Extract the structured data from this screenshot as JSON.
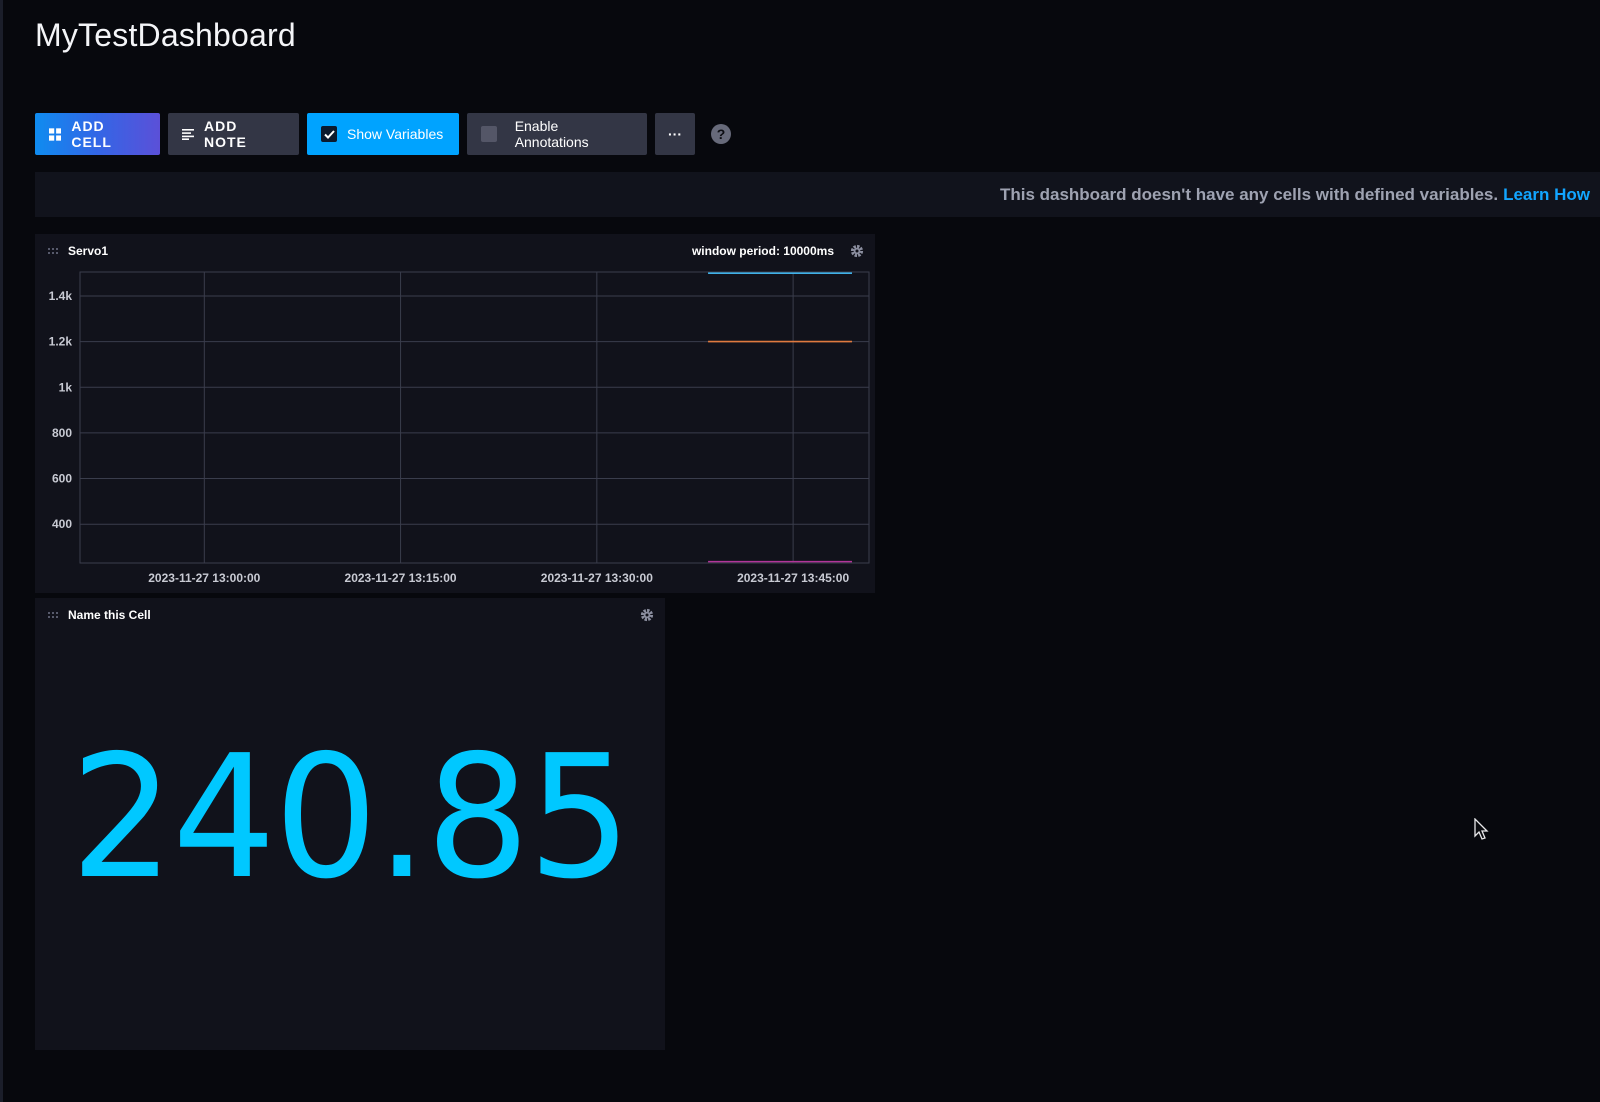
{
  "dashboard": {
    "title": "MyTestDashboard"
  },
  "toolbar": {
    "add_cell": "ADD CELL",
    "add_note": "ADD NOTE",
    "show_variables": "Show Variables",
    "show_variables_checked": true,
    "enable_annotations": "Enable Annotations",
    "enable_annotations_checked": false,
    "more": "···",
    "help": "?"
  },
  "variables_bar": {
    "message": "This dashboard doesn't have any cells with defined variables.",
    "link": "Learn How"
  },
  "cells": [
    {
      "title": "Servo1",
      "note": "window period: 10000ms",
      "icons": [
        "drag-handle-icon",
        "gear-icon"
      ]
    },
    {
      "title": "Name this Cell",
      "value": "240.85",
      "value_color": "#00c8ff",
      "icons": [
        "drag-handle-icon",
        "gear-icon"
      ]
    }
  ],
  "chart_data": {
    "type": "line",
    "x_ticks": [
      "2023-11-27 13:00:00",
      "2023-11-27 13:15:00",
      "2023-11-27 13:30:00",
      "2023-11-27 13:45:00"
    ],
    "y_ticks": [
      "400",
      "600",
      "800",
      "1k",
      "1.2k",
      "1.4k"
    ],
    "y_tick_values": [
      400,
      600,
      800,
      1000,
      1200,
      1400
    ],
    "ylim": [
      230,
      1505
    ],
    "x_range_minutes_after_1300": [
      -9.5,
      50.8
    ],
    "grid": true,
    "series": [
      {
        "color": "#3fb1e8",
        "x": [
          "2023-11-27 13:38:30",
          "2023-11-27 13:49:30"
        ],
        "y": [
          1500,
          1500
        ]
      },
      {
        "color": "#e07a3f",
        "x": [
          "2023-11-27 13:38:30",
          "2023-11-27 13:49:30"
        ],
        "y": [
          1200,
          1200
        ]
      },
      {
        "color": "#b2359a",
        "x": [
          "2023-11-27 13:38:30",
          "2023-11-27 13:49:30"
        ],
        "y": [
          236,
          236
        ]
      }
    ]
  },
  "colors": {
    "background": "#07080d",
    "cell_background": "#11121b",
    "accent_blue": "#00a3ff",
    "link_blue": "#12a5ff"
  }
}
